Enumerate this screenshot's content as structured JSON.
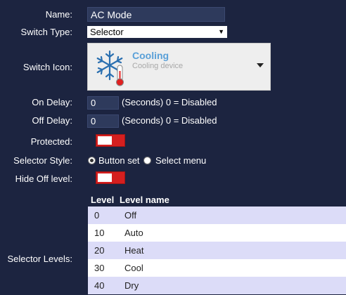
{
  "labels": {
    "name": "Name:",
    "switch_type": "Switch Type:",
    "switch_icon": "Switch Icon:",
    "on_delay": "On Delay:",
    "off_delay": "Off Delay:",
    "protected": "Protected:",
    "selector_style": "Selector Style:",
    "hide_off_level": "Hide Off level:",
    "selector_levels": "Selector Levels:"
  },
  "name_value": "AC Mode",
  "switch_type": {
    "value": "Selector"
  },
  "switch_icon": {
    "title": "Cooling",
    "subtitle": "Cooling device",
    "icon": "snowflake-thermometer-icon"
  },
  "on_delay": {
    "value": "0",
    "hint": "(Seconds) 0 = Disabled"
  },
  "off_delay": {
    "value": "0",
    "hint": "(Seconds) 0 = Disabled"
  },
  "protected": {
    "on": false
  },
  "selector_style": {
    "options": [
      {
        "label": "Button set",
        "checked": true
      },
      {
        "label": "Select menu",
        "checked": false
      }
    ]
  },
  "hide_off_level": {
    "on": false
  },
  "levels_table": {
    "headers": [
      "Level",
      "Level name"
    ],
    "rows": [
      {
        "level": "0",
        "name": "Off"
      },
      {
        "level": "10",
        "name": "Auto"
      },
      {
        "level": "20",
        "name": "Heat"
      },
      {
        "level": "30",
        "name": "Cool"
      },
      {
        "level": "40",
        "name": "Dry"
      }
    ]
  },
  "colors": {
    "background": "#1c2440",
    "toggle_off": "#d51f1f",
    "accent_title": "#5aa0d8",
    "row_alt": "#dcdcf8"
  }
}
